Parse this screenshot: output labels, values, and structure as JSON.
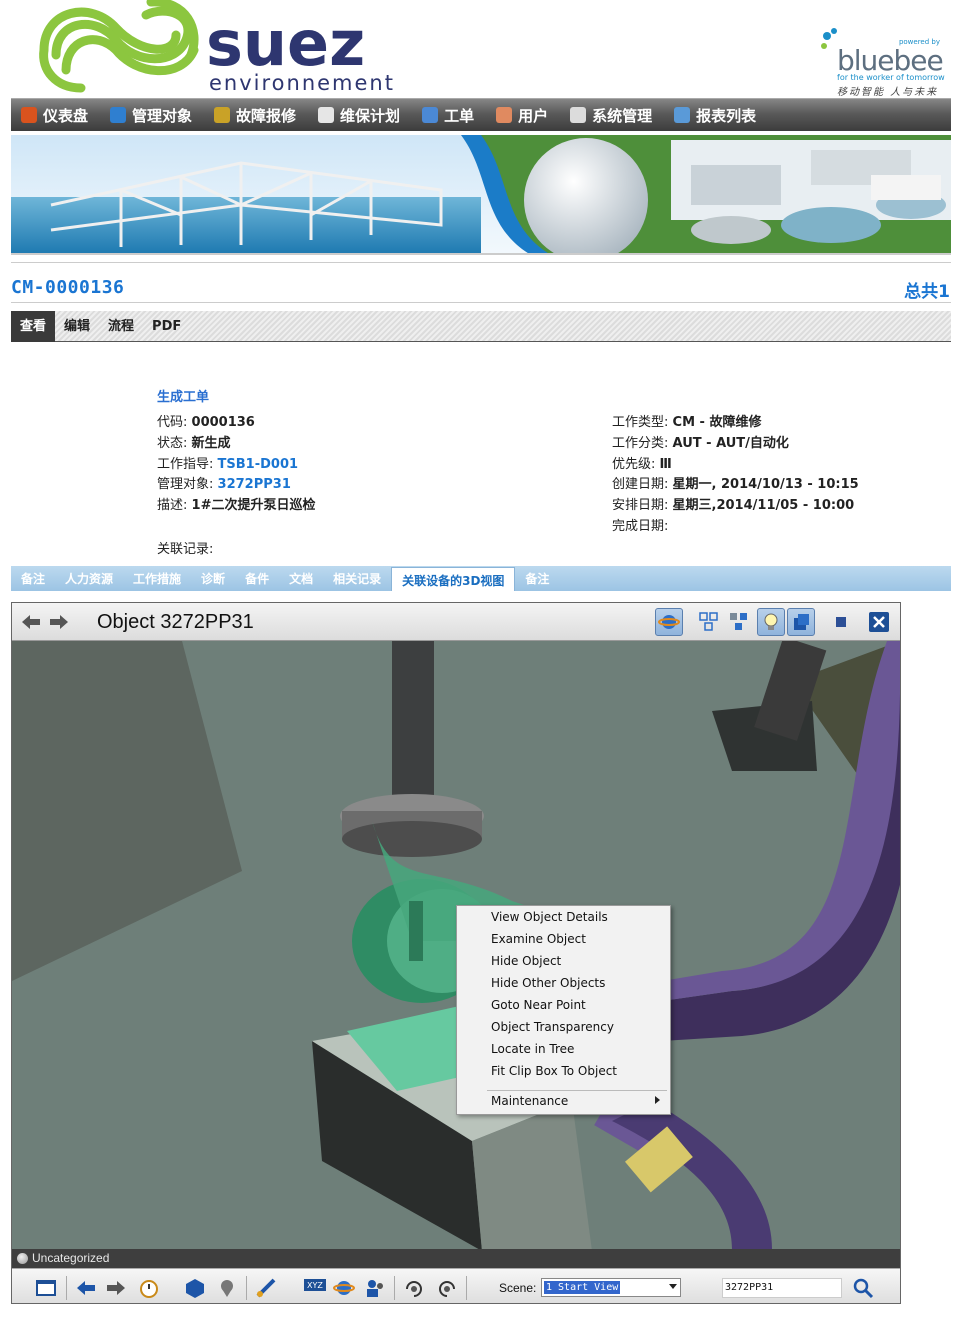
{
  "brand": {
    "logo_text": "suez",
    "logo_sub": "environnement",
    "partner_powered": "powered by",
    "partner_name": "bluebee",
    "partner_tagline": "for the worker of tomorrow",
    "partner_cn": "移动智能 人与未来"
  },
  "nav": {
    "items": [
      {
        "label": "仪表盘",
        "icon": "dashboard-icon"
      },
      {
        "label": "管理对象",
        "icon": "globe-icon"
      },
      {
        "label": "故障报修",
        "icon": "repair-icon"
      },
      {
        "label": "维保计划",
        "icon": "plan-icon"
      },
      {
        "label": "工单",
        "icon": "workorder-icon"
      },
      {
        "label": "用户",
        "icon": "users-icon"
      },
      {
        "label": "系统管理",
        "icon": "tools-icon"
      },
      {
        "label": "报表列表",
        "icon": "report-icon"
      }
    ]
  },
  "record": {
    "code": "CM-0000136",
    "total": "总共1"
  },
  "subtabs": [
    "查看",
    "编辑",
    "流程",
    "PDF"
  ],
  "detail": {
    "section_title": "生成工单",
    "left": [
      {
        "label": "代码:",
        "value": "0000136",
        "link": false
      },
      {
        "label": "状态:",
        "value": "新生成",
        "link": false
      },
      {
        "label": "工作指导:",
        "value": "TSB1-D001",
        "link": true
      },
      {
        "label": "管理对象:",
        "value": "3272PP31",
        "link": true
      },
      {
        "label": "描述:",
        "value": "1#二次提升泵日巡检",
        "link": false
      }
    ],
    "right": [
      {
        "label": "工作类型:",
        "value": "CM - 故障维修"
      },
      {
        "label": "工作分类:",
        "value": "AUT - AUT/自动化"
      },
      {
        "label": "优先级:",
        "value": "Ⅲ"
      },
      {
        "label": "创建日期:",
        "value": "星期一, 2014/10/13 - 10:15"
      },
      {
        "label": "安排日期:",
        "value": "星期三,2014/11/05 - 10:00"
      },
      {
        "label": "完成日期:",
        "value": ""
      }
    ],
    "related_label": "关联记录:"
  },
  "tabs": [
    "备注",
    "人力资源",
    "工作措施",
    "诊断",
    "备件",
    "文档",
    "相关记录",
    "关联设备的3D视图",
    "备注"
  ],
  "viewer": {
    "title": "Object 3272PP31",
    "category": "Uncategorized",
    "scene_label": "Scene:",
    "scene_value": "1 Start View",
    "object_field": "3272PP31"
  },
  "context_menu": {
    "items": [
      "View Object Details",
      "Examine Object",
      "Hide Object",
      "Hide Other Objects",
      "Goto Near Point",
      "Object Transparency",
      "Locate in Tree",
      "Fit Clip Box To Object"
    ],
    "submenu": "Maintenance"
  },
  "colors": {
    "accent_blue": "#1a75d2",
    "nav_bg": "#4a4a4a",
    "tab_bar": "#a9cce8",
    "scene_bg": "#6e7f79"
  }
}
